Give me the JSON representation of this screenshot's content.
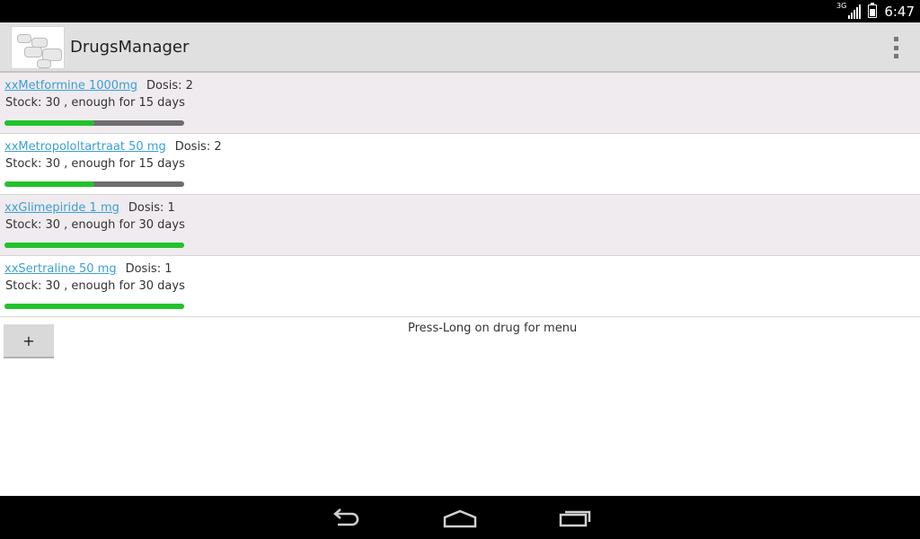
{
  "status": {
    "network": "3G",
    "time": "6:47"
  },
  "app": {
    "title": "DrugsManager"
  },
  "drugs": [
    {
      "name": "xxMetformine 1000mg",
      "dosis": "Dosis: 2",
      "stock": "Stock: 30 , enough for 15 days",
      "progress": 0.5
    },
    {
      "name": "xxMetropololtartraat 50 mg",
      "dosis": "Dosis: 2",
      "stock": "Stock: 30 , enough for 15 days",
      "progress": 0.5
    },
    {
      "name": "xxGlimepiride 1 mg",
      "dosis": "Dosis: 1",
      "stock": "Stock: 30 , enough for 30 days",
      "progress": 1.0
    },
    {
      "name": "xxSertraline 50 mg",
      "dosis": "Dosis: 1",
      "stock": "Stock: 30 , enough for 30 days",
      "progress": 1.0
    }
  ],
  "actions": {
    "add_label": "+",
    "hint": "Press-Long on drug for menu"
  },
  "colors": {
    "progress_fill": "#22c22b",
    "progress_track": "#6e6e6e",
    "link": "#3b9fd6",
    "alt_row": "#efebee"
  }
}
